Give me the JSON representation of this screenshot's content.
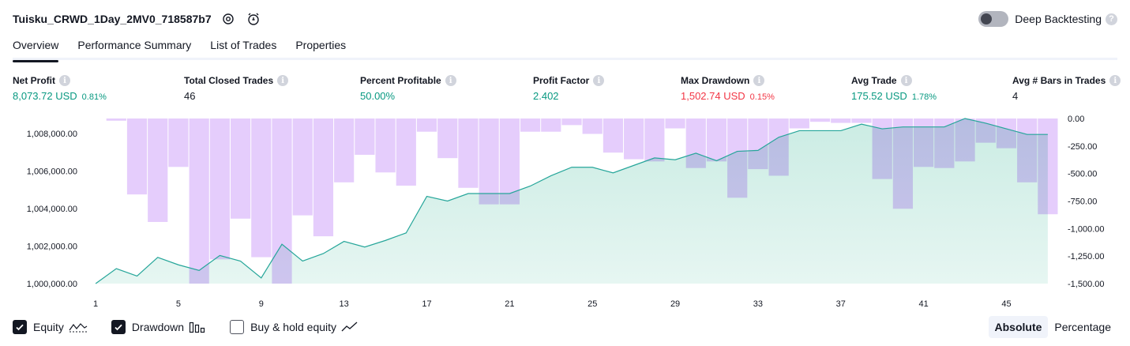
{
  "strategy": {
    "name": "Tuisku_CRWD_1Day_2MV0_718587b7"
  },
  "deep_backtesting": {
    "label": "Deep Backtesting",
    "enabled": false
  },
  "tabs": [
    {
      "label": "Overview",
      "active": true
    },
    {
      "label": "Performance Summary",
      "active": false
    },
    {
      "label": "List of Trades",
      "active": false
    },
    {
      "label": "Properties",
      "active": false
    }
  ],
  "metrics": {
    "net_profit": {
      "label": "Net Profit",
      "value": "8,073.72 USD",
      "pct": "0.81%"
    },
    "total_closed_trades": {
      "label": "Total Closed Trades",
      "value": "46"
    },
    "percent_profitable": {
      "label": "Percent Profitable",
      "value": "50.00%"
    },
    "profit_factor": {
      "label": "Profit Factor",
      "value": "2.402"
    },
    "max_drawdown": {
      "label": "Max Drawdown",
      "value": "1,502.74 USD",
      "pct": "0.15%"
    },
    "avg_trade": {
      "label": "Avg Trade",
      "value": "175.52 USD",
      "pct": "1.78%"
    },
    "avg_bars": {
      "label": "Avg # Bars in Trades",
      "value": "4"
    }
  },
  "colors": {
    "equity_line": "#26a69a",
    "equity_fill": "#c8ebe2",
    "drawdown_bar": "#e1c4fb",
    "drawdown_overlap": "#b9b8ea",
    "positive": "#089981",
    "negative": "#f23645"
  },
  "chart_data": {
    "type": "line",
    "x_ticks": [
      "1",
      "5",
      "9",
      "13",
      "17",
      "21",
      "25",
      "29",
      "33",
      "37",
      "41",
      "45"
    ],
    "left_axis_ticks": [
      "1,008,000.00",
      "1,006,000.00",
      "1,004,000.00",
      "1,002,000.00",
      "1,000,000.00"
    ],
    "right_axis_ticks": [
      "0.00",
      "-250.00",
      "-500.00",
      "-750.00",
      "-1,000.00",
      "-1,250.00",
      "-1,500.00"
    ],
    "ylim_left": [
      1000000,
      1008800
    ],
    "ylim_right": [
      -1500,
      0
    ],
    "series": [
      {
        "name": "Equity",
        "type": "area",
        "x": [
          1,
          2,
          3,
          4,
          5,
          6,
          7,
          8,
          9,
          10,
          11,
          12,
          13,
          14,
          15,
          16,
          17,
          18,
          19,
          20,
          21,
          22,
          23,
          24,
          25,
          26,
          27,
          28,
          29,
          30,
          31,
          32,
          33,
          34,
          35,
          36,
          37,
          38,
          39,
          40,
          41,
          42,
          43,
          44,
          45,
          46,
          47
        ],
        "values": [
          1000000,
          1000800,
          1000400,
          1001400,
          1001000,
          1000700,
          1001500,
          1001200,
          1000300,
          1002100,
          1001200,
          1001600,
          1002250,
          1001950,
          1002300,
          1002700,
          1004650,
          1004400,
          1004800,
          1004800,
          1004800,
          1005200,
          1005750,
          1006200,
          1006200,
          1005900,
          1006300,
          1006700,
          1006600,
          1006950,
          1006550,
          1007050,
          1007100,
          1007800,
          1008150,
          1008150,
          1008150,
          1008500,
          1008250,
          1008350,
          1008350,
          1008350,
          1008800,
          1008550,
          1008250,
          1007950,
          1007950
        ]
      },
      {
        "name": "Drawdown",
        "type": "bar",
        "x": [
          1,
          2,
          3,
          4,
          5,
          6,
          7,
          8,
          9,
          10,
          11,
          12,
          13,
          14,
          15,
          16,
          17,
          18,
          19,
          20,
          21,
          22,
          23,
          24,
          25,
          26,
          27,
          28,
          29,
          30,
          31,
          32,
          33,
          34,
          35,
          36,
          37,
          38,
          39,
          40,
          41,
          42,
          43,
          44,
          45,
          46,
          47
        ],
        "values": [
          0,
          -20,
          -690,
          -940,
          -440,
          -1500,
          -1280,
          -910,
          -1260,
          -1500,
          -880,
          -1070,
          -580,
          -330,
          -490,
          -610,
          -120,
          -360,
          -630,
          -780,
          -780,
          -120,
          -120,
          -60,
          -140,
          -310,
          -370,
          -390,
          -90,
          -450,
          -390,
          -720,
          -460,
          -520,
          -90,
          -30,
          -40,
          -40,
          -550,
          -820,
          -440,
          -450,
          -390,
          -220,
          -270,
          -580,
          -870
        ]
      }
    ]
  },
  "legend": {
    "equity_label": "Equity",
    "equity_checked": true,
    "drawdown_label": "Drawdown",
    "drawdown_checked": true,
    "buyhold_label": "Buy & hold equity",
    "buyhold_checked": false
  },
  "view_mode": {
    "absolute_label": "Absolute",
    "percentage_label": "Percentage",
    "selected": "Absolute"
  }
}
